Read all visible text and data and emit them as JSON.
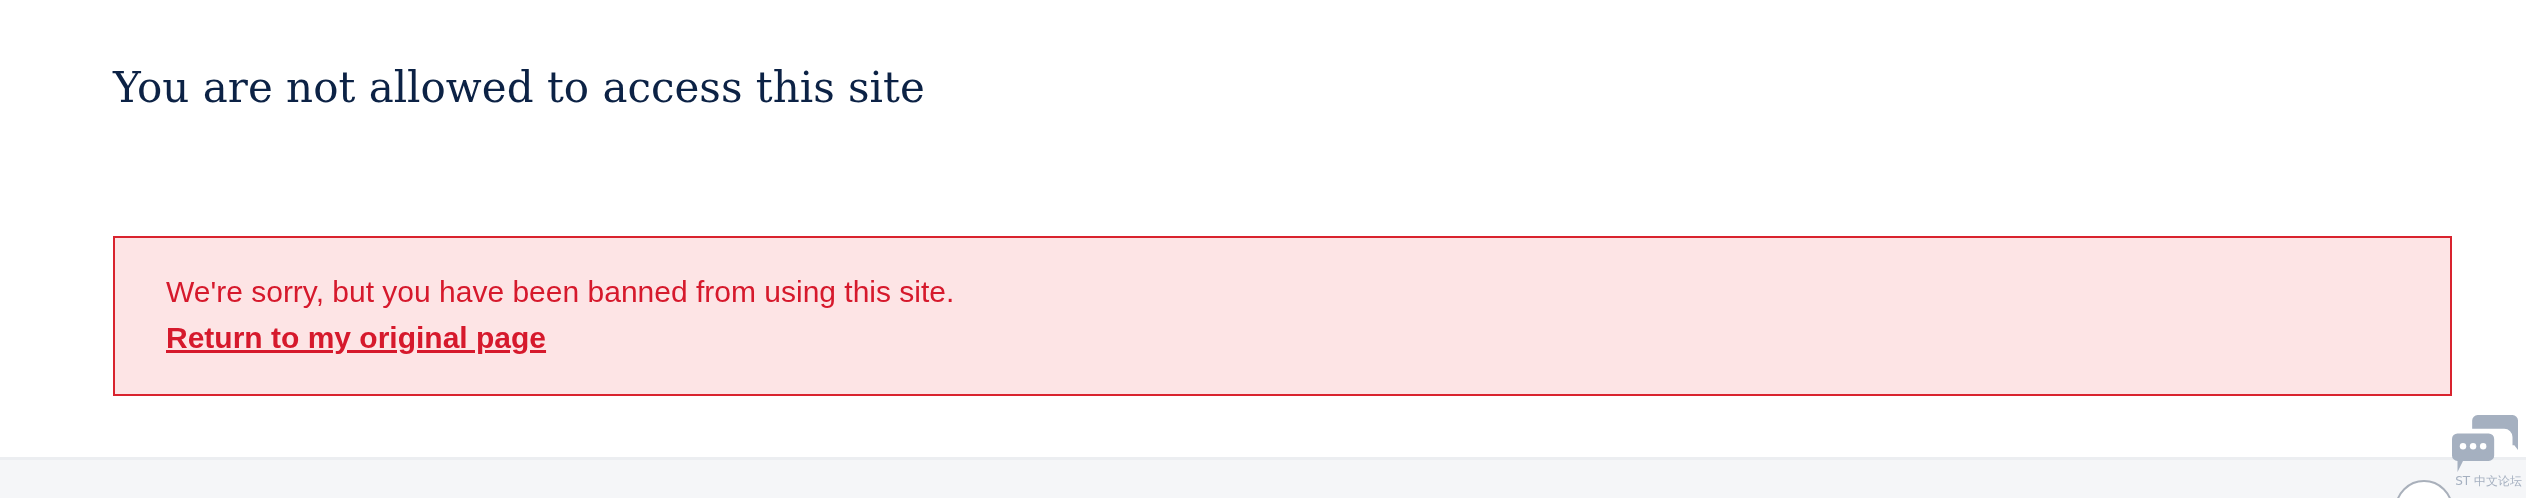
{
  "heading": "You are not allowed to access this site",
  "alert": {
    "message": "We're sorry, but you have been banned from using this site.",
    "link": "Return to my original page"
  },
  "chat_widget": {
    "label": "ST 中文论坛"
  }
}
